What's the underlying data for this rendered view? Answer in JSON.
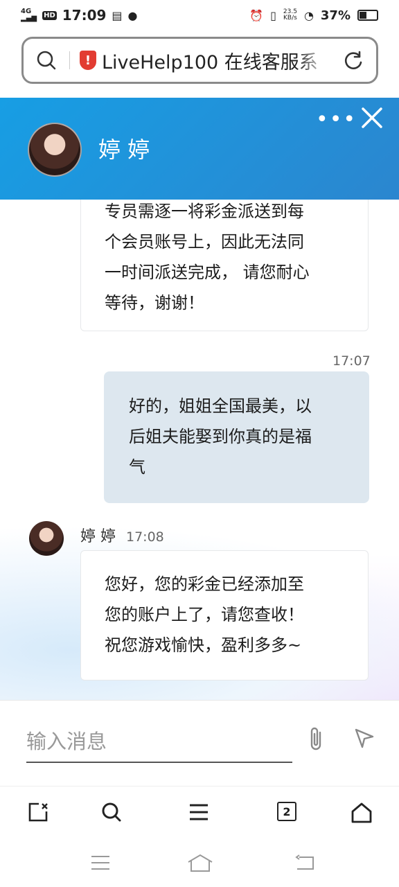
{
  "status_bar": {
    "network": "4G",
    "hd": "HD",
    "time": "17:09",
    "speed_value": "23.5",
    "speed_unit": "KB/s",
    "battery": "37%",
    "battery_level": 0.37
  },
  "address_bar": {
    "url_title": "LiveHelp100 在线客服系"
  },
  "chat_header": {
    "agent_name": "婷 婷",
    "more_label": "•••"
  },
  "messages": [
    {
      "direction": "incoming",
      "lines": [
        "专员需逐一将彩金派送到每",
        "个会员账号上，因此无法同",
        "一时间派送完成， 请您耐心",
        "等待，谢谢！"
      ]
    },
    {
      "direction": "outgoing",
      "time": "17:07",
      "lines": [
        "好的，姐姐全国最美，以",
        "后姐夫能娶到你真的是福",
        "气"
      ]
    },
    {
      "direction": "incoming",
      "sender": "婷 婷",
      "time": "17:08",
      "lines": [
        "您好，您的彩金已经添加至",
        "您的账户上了，请您查收！",
        "祝您游戏愉快，盈利多多~"
      ]
    }
  ],
  "input": {
    "placeholder": "输入消息",
    "value": ""
  },
  "browser_toolbar": {
    "tab_count": "2"
  }
}
